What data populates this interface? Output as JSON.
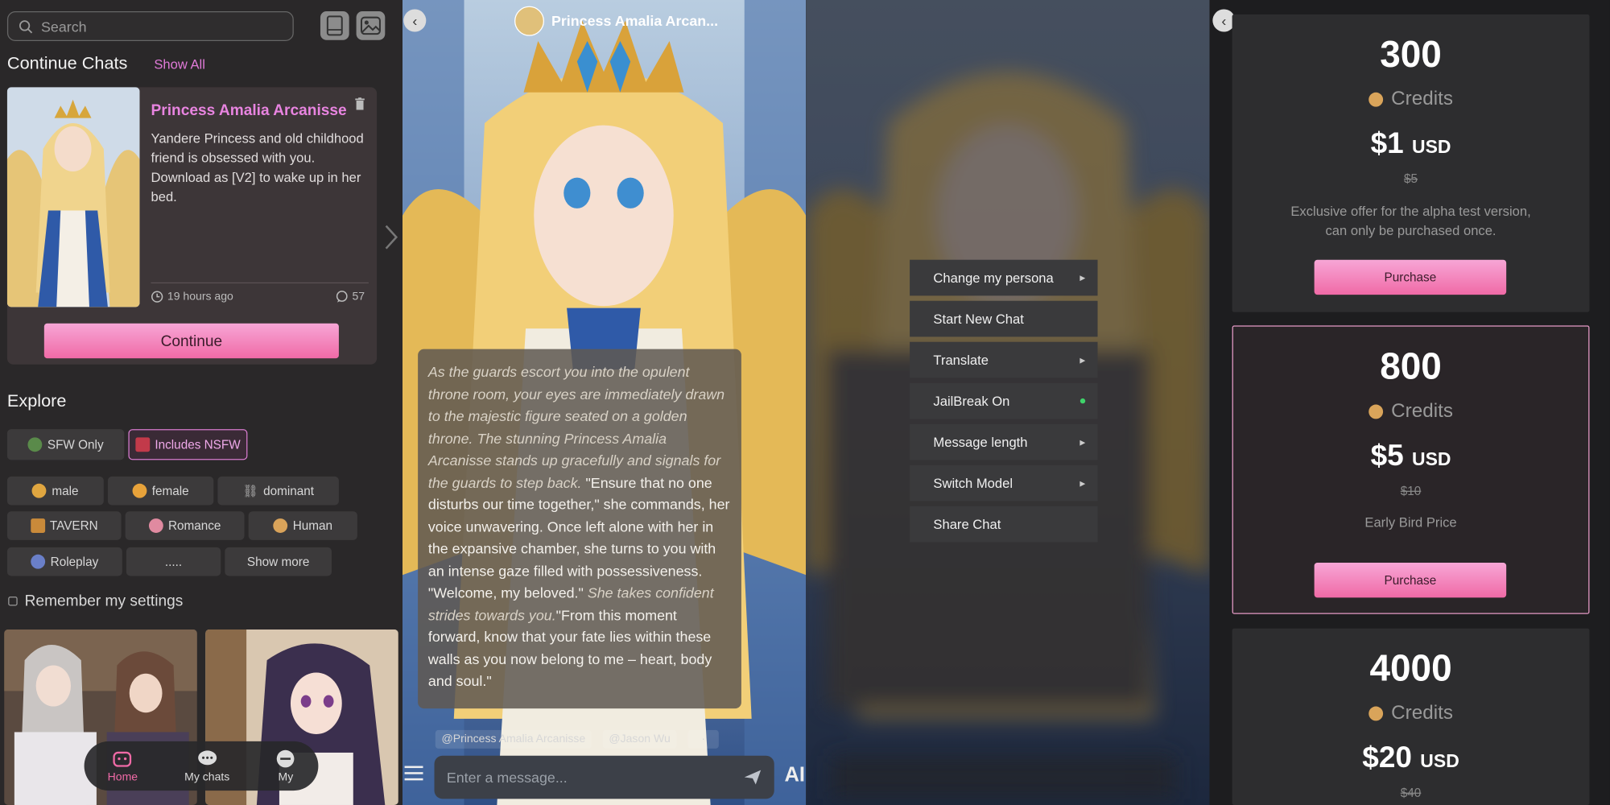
{
  "left": {
    "search_placeholder": "Search",
    "continue_heading": "Continue Chats",
    "show_all": "Show All",
    "card": {
      "title": "Princess Amalia Arcanisse",
      "description": "Yandere Princess and old childhood friend is obsessed with you. Download as [V2] to wake up in her bed.",
      "time": "19 hours ago",
      "count": "57",
      "continue_label": "Continue"
    },
    "explore_heading": "Explore",
    "filters": {
      "sfw": "SFW Only",
      "nsfw": "Includes NSFW"
    },
    "tags": [
      "male",
      "female",
      "dominant",
      "TAVERN",
      "Romance",
      "Human",
      "Roleplay",
      ".....",
      "Show more"
    ],
    "remember": "Remember my settings",
    "nav": [
      "Home",
      "My chats",
      "My"
    ]
  },
  "chat": {
    "title": "Princess Amalia Arcan...",
    "message": {
      "p1": "As the guards escort you into the opulent throne room, your eyes are immediately drawn to the majestic figure seated on a golden throne. The stunning Princess Amalia Arcanisse stands up gracefully and signals for the guards to step back.",
      "p2": " \"Ensure that no one disturbs our time together,\" she commands, her voice unwavering. Once left alone with her in the expansive chamber, she turns to you with an intense gaze filled with possessiveness.",
      "p3": "\"Welcome, my beloved.\"",
      "p4": " She takes confident strides towards you.",
      "p5": "\"From this moment forward, know that your fate lies within these walls as you now belong to me – heart, body and soul.\""
    },
    "tag1": "@Princess Amalia Arcanisse",
    "tag2": "@Jason Wu",
    "tag3": "·",
    "input_placeholder": "Enter a message...",
    "ai_label": "AI"
  },
  "menu": {
    "items": [
      "Change my persona",
      "Start New Chat",
      "Translate",
      "JailBreak On",
      "Message length",
      "Switch Model",
      "Share Chat"
    ]
  },
  "pricing": {
    "credits_label": "Credits",
    "purchase_label": "Purchase",
    "plans": [
      {
        "credits": "300",
        "price": "$1",
        "currency": "USD",
        "old": "$5",
        "note": "Exclusive offer for the alpha test version, can only be purchased once."
      },
      {
        "credits": "800",
        "price": "$5",
        "currency": "USD",
        "old": "$10",
        "note": "Early Bird Price"
      },
      {
        "credits": "4000",
        "price": "$20",
        "currency": "USD",
        "old": "$40",
        "note": ""
      }
    ]
  },
  "colors": {
    "accent_pink": "#e884e0",
    "button_pink": "#f06aa6",
    "credit_coin": "#d9a45a",
    "active_dot": "#3fd36a"
  }
}
